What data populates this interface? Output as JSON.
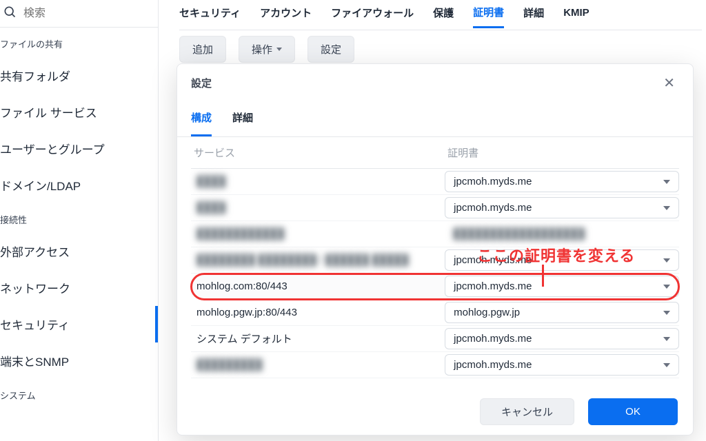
{
  "search": {
    "placeholder": "検索"
  },
  "sidebar": {
    "groups": [
      {
        "header": "ファイルの共有",
        "items": [
          "共有フォルダ",
          "ファイル サービス",
          "ユーザーとグループ",
          "ドメイン/LDAP"
        ]
      },
      {
        "header": "接続性",
        "items": [
          "外部アクセス",
          "ネットワーク",
          "セキュリティ",
          "端末とSNMP"
        ]
      },
      {
        "header": "システム",
        "items": []
      }
    ],
    "active": "セキュリティ"
  },
  "tabs": {
    "items": [
      "セキュリティ",
      "アカウント",
      "ファイアウォール",
      "保護",
      "証明書",
      "詳細",
      "KMIP"
    ],
    "active": "証明書"
  },
  "toolbar": {
    "add": "追加",
    "actions": "操作",
    "settings": "設定"
  },
  "modal": {
    "title": "設定",
    "subtabs": {
      "items": [
        "構成",
        "詳細"
      ],
      "active": "構成"
    },
    "columns": {
      "service": "サービス",
      "certificate": "証明書"
    },
    "rows": [
      {
        "service": "████",
        "cert": "jpcmoh.myds.me",
        "blurredService": true
      },
      {
        "service": "████",
        "cert": "jpcmoh.myds.me",
        "blurredService": true
      },
      {
        "service": "████████████",
        "cert": "██████████████████",
        "blurredService": true,
        "blurredCert": true,
        "noedit": true
      },
      {
        "service": "████████ ████████ / ██████ █████",
        "cert": "jpcmoh.myds.me",
        "blurredService": true
      },
      {
        "service": "mohlog.com:80/443",
        "cert": "jpcmoh.myds.me",
        "highlight": true
      },
      {
        "service": "mohlog.pgw.jp:80/443",
        "cert": "mohlog.pgw.jp"
      },
      {
        "service": "システム デフォルト",
        "cert": "jpcmoh.myds.me"
      },
      {
        "service": "█████████",
        "cert": "jpcmoh.myds.me",
        "blurredService": true
      }
    ],
    "buttons": {
      "cancel": "キャンセル",
      "ok": "OK"
    }
  },
  "annotation": "ここの証明書を変える"
}
